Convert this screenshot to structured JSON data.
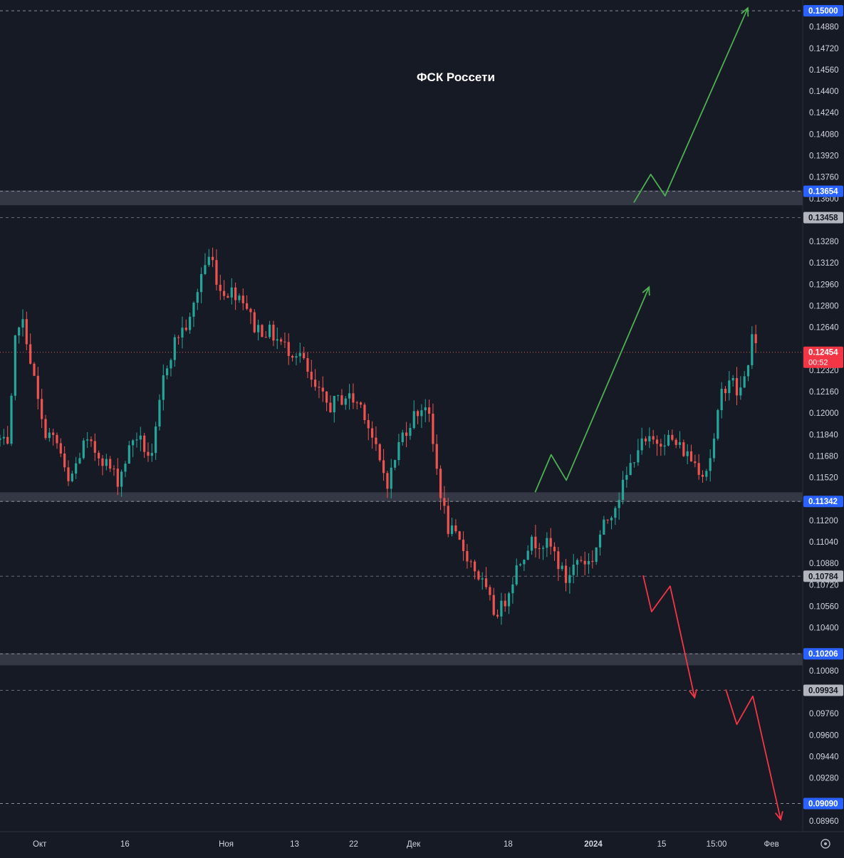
{
  "colors": {
    "background": "#161a25",
    "up": "#26a69a",
    "down": "#ef5350",
    "bullish_arrow": "#4caf50",
    "bearish_arrow": "#f23645",
    "zone": "#3a3e4a",
    "axis_text": "#d1d4dc",
    "blue_badge": "#2962ff",
    "gray_badge": "#b2b5be",
    "red_badge": "#f23645"
  },
  "chart_data": {
    "type": "candlestick",
    "title": "ФСК Россети",
    "ylim": [
      0.0888,
      0.1508
    ],
    "xlim": [
      0,
      100
    ],
    "y_ticks": [
      "0.14880",
      "0.14720",
      "0.14560",
      "0.14400",
      "0.14240",
      "0.14080",
      "0.13920",
      "0.13760",
      "0.13600",
      "0.13280",
      "0.13120",
      "0.12960",
      "0.12800",
      "0.12640",
      "0.12320",
      "0.12160",
      "0.12000",
      "0.11840",
      "0.11680",
      "0.11520",
      "0.11200",
      "0.11040",
      "0.10880",
      "0.10720",
      "0.10560",
      "0.10400",
      "0.10080",
      "0.09760",
      "0.09600",
      "0.09440",
      "0.09280",
      "0.08960"
    ],
    "x_ticks": [
      {
        "label": "Окт",
        "x": 4.7
      },
      {
        "label": "16",
        "x": 14.8
      },
      {
        "label": "Ноя",
        "x": 26.8
      },
      {
        "label": "13",
        "x": 34.9
      },
      {
        "label": "22",
        "x": 41.9
      },
      {
        "label": "Дек",
        "x": 49.0
      },
      {
        "label": "18",
        "x": 60.2
      },
      {
        "label": "2024",
        "x": 70.3
      },
      {
        "label": "15",
        "x": 78.4
      },
      {
        "label": "15:00",
        "x": 84.9
      },
      {
        "label": "Фев",
        "x": 91.4
      }
    ],
    "levels": [
      {
        "label": "0.15000",
        "value": 0.15,
        "style": "solid",
        "badge": "blue"
      },
      {
        "label": "0.13654",
        "value": 0.13654,
        "style": "solid",
        "badge": "blue",
        "zone": [
          0.1355,
          0.1366
        ]
      },
      {
        "label": "0.13458",
        "value": 0.13458,
        "style": "dashed",
        "badge": "gray"
      },
      {
        "label": "0.11342",
        "value": 0.11342,
        "style": "solid",
        "badge": "blue",
        "zone": [
          0.1134,
          0.1141
        ]
      },
      {
        "label": "0.10784",
        "value": 0.10784,
        "style": "dashed",
        "badge": "gray"
      },
      {
        "label": "0.10206",
        "value": 0.10206,
        "style": "solid",
        "badge": "blue",
        "zone": [
          0.1012,
          0.1021
        ]
      },
      {
        "label": "0.09934",
        "value": 0.09934,
        "style": "dashed",
        "badge": "gray"
      },
      {
        "label": "0.09090",
        "value": 0.0909,
        "style": "solid",
        "badge": "blue"
      }
    ],
    "current_price": {
      "label": "0.12454",
      "value": 0.12454,
      "countdown": "00:52"
    },
    "anchors": [
      [
        0,
        0.118
      ],
      [
        1,
        0.1172
      ],
      [
        2,
        0.1272
      ],
      [
        3,
        0.1262
      ],
      [
        5,
        0.119
      ],
      [
        7,
        0.1175
      ],
      [
        8,
        0.1145
      ],
      [
        10,
        0.1178
      ],
      [
        12,
        0.1168
      ],
      [
        14,
        0.115
      ],
      [
        16,
        0.1185
      ],
      [
        18,
        0.1165
      ],
      [
        19.5,
        0.1232
      ],
      [
        21,
        0.1258
      ],
      [
        22.5,
        0.1268
      ],
      [
        24,
        0.1308
      ],
      [
        25,
        0.1318
      ],
      [
        26,
        0.1292
      ],
      [
        28,
        0.129
      ],
      [
        29,
        0.1285
      ],
      [
        30,
        0.1265
      ],
      [
        32,
        0.126
      ],
      [
        34,
        0.1248
      ],
      [
        35.5,
        0.1245
      ],
      [
        37,
        0.122
      ],
      [
        39,
        0.1205
      ],
      [
        41,
        0.1213
      ],
      [
        43,
        0.1205
      ],
      [
        45,
        0.1162
      ],
      [
        46,
        0.1148
      ],
      [
        47.5,
        0.1182
      ],
      [
        49,
        0.1198
      ],
      [
        50.5,
        0.1208
      ],
      [
        52,
        0.1148
      ],
      [
        53,
        0.1115
      ],
      [
        55,
        0.1098
      ],
      [
        57,
        0.1075
      ],
      [
        58.5,
        0.1052
      ],
      [
        59.5,
        0.1055
      ],
      [
        61,
        0.1082
      ],
      [
        62.5,
        0.1102
      ],
      [
        64,
        0.1105
      ],
      [
        65.5,
        0.1098
      ],
      [
        67,
        0.1075
      ],
      [
        68.5,
        0.1092
      ],
      [
        70,
        0.1088
      ],
      [
        71,
        0.1108
      ],
      [
        72.5,
        0.1128
      ],
      [
        74,
        0.1148
      ],
      [
        75.5,
        0.1175
      ],
      [
        77,
        0.1178
      ],
      [
        79,
        0.1182
      ],
      [
        81,
        0.1172
      ],
      [
        82.5,
        0.1162
      ],
      [
        83.5,
        0.1155
      ],
      [
        84.5,
        0.1175
      ],
      [
        85.5,
        0.1215
      ],
      [
        86.5,
        0.1228
      ],
      [
        87.5,
        0.1212
      ],
      [
        88.5,
        0.1232
      ],
      [
        89,
        0.1258
      ],
      [
        89.6,
        0.1246
      ]
    ],
    "arrows": [
      {
        "color": "bullish",
        "points": [
          [
            63.4,
            0.1141
          ],
          [
            65.3,
            0.1169
          ],
          [
            67.1,
            0.115
          ],
          [
            76.9,
            0.1294
          ]
        ]
      },
      {
        "color": "bullish",
        "points": [
          [
            75.1,
            0.1357
          ],
          [
            77.1,
            0.1378
          ],
          [
            78.8,
            0.1362
          ],
          [
            88.6,
            0.1502
          ]
        ]
      },
      {
        "color": "bearish",
        "points": [
          [
            76.2,
            0.1079
          ],
          [
            77.2,
            0.1052
          ],
          [
            79.4,
            0.1071
          ],
          [
            82.3,
            0.0988
          ]
        ]
      },
      {
        "color": "bearish",
        "points": [
          [
            86.0,
            0.0994
          ],
          [
            87.3,
            0.0968
          ],
          [
            89.2,
            0.0989
          ],
          [
            92.5,
            0.0897
          ]
        ]
      }
    ]
  }
}
